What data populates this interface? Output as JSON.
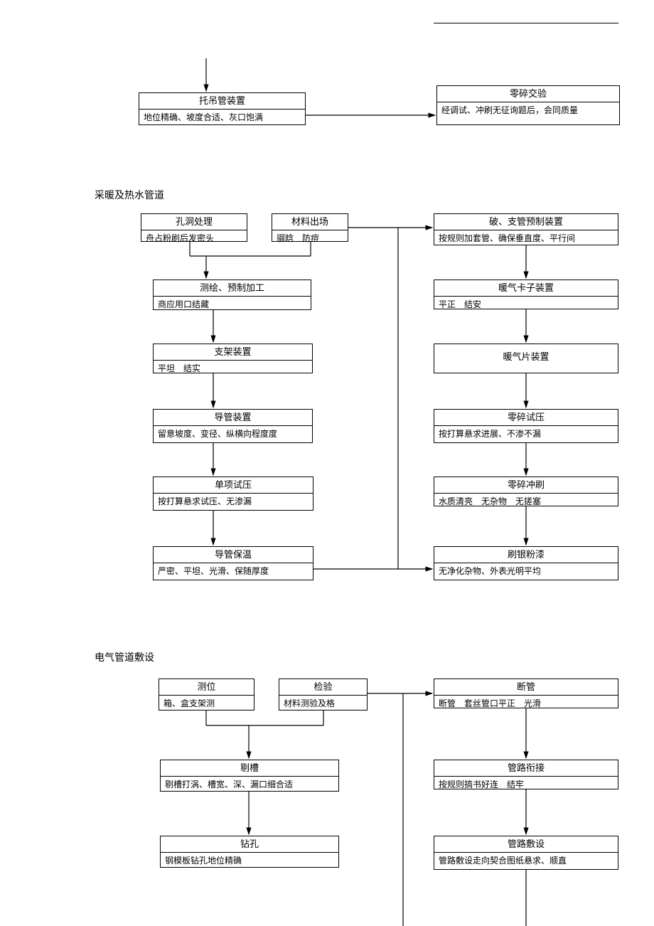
{
  "section1": {
    "box1": {
      "title": "托吊管装置",
      "sub": "地位精确、坡度合适、灰口饱满"
    },
    "box2": {
      "title": "零碎交验",
      "sub": "经调试、冲刷无征询题后，会同质量"
    }
  },
  "section2": {
    "label": "采暖及热水管道",
    "left": {
      "b1": {
        "title": "孔洞处理",
        "sub": "舟占粉刷后发密头"
      },
      "b2": {
        "title": "材料出场",
        "sub": "骝晗　防痘"
      },
      "b3": {
        "title": "测绘、预制加工",
        "sub": "商应用口结藏"
      },
      "b4": {
        "title": "支架装置",
        "sub": "平坦　结实"
      },
      "b5": {
        "title": "导管装置",
        "sub": "留意坡度、变径、纵横向程度度"
      },
      "b6": {
        "title": "单项试压",
        "sub": "按打算悬求试压、无渗漏"
      },
      "b7": {
        "title": "导管保温",
        "sub": "严密、平坦、光滑、保随厚度"
      }
    },
    "right": {
      "b1": {
        "title": "破、支管预制装置",
        "sub": "按规则加套管、确保垂直度、平行间"
      },
      "b2": {
        "title": "暖气卡子装置",
        "sub": "平正　结安"
      },
      "b3": {
        "title": "暖气片装置",
        "sub": ""
      },
      "b4": {
        "title": "零碎试压",
        "sub": "按打算悬求进展、不渗不漏"
      },
      "b5": {
        "title": "零碎冲刷",
        "sub": "水质清亮　无杂物　无搓塞"
      },
      "b6": {
        "title": "刷银粉漆",
        "sub": "无净化杂物、外表光明平均"
      }
    }
  },
  "section3": {
    "label": "电气管道敷设",
    "left": {
      "b1": {
        "title": "测位",
        "sub": "箱、盒支架测"
      },
      "b2": {
        "title": "检验",
        "sub": "材料测验及格"
      },
      "b3": {
        "title": "剔槽",
        "sub": "剔槽打涡、槽宽、深、漏口细合适"
      },
      "b4": {
        "title": "钻孔",
        "sub": "钢模板钻孔地位精确"
      }
    },
    "right": {
      "b1": {
        "title": "断管",
        "sub": "断管　套丝管口平正　光滑"
      },
      "b2": {
        "title": "管路衔接",
        "sub": "按规则搞书好连　结牢"
      },
      "b3": {
        "title": "管路敷设",
        "sub": "管路敷设走向契合图纸悬求、顺直"
      }
    }
  }
}
